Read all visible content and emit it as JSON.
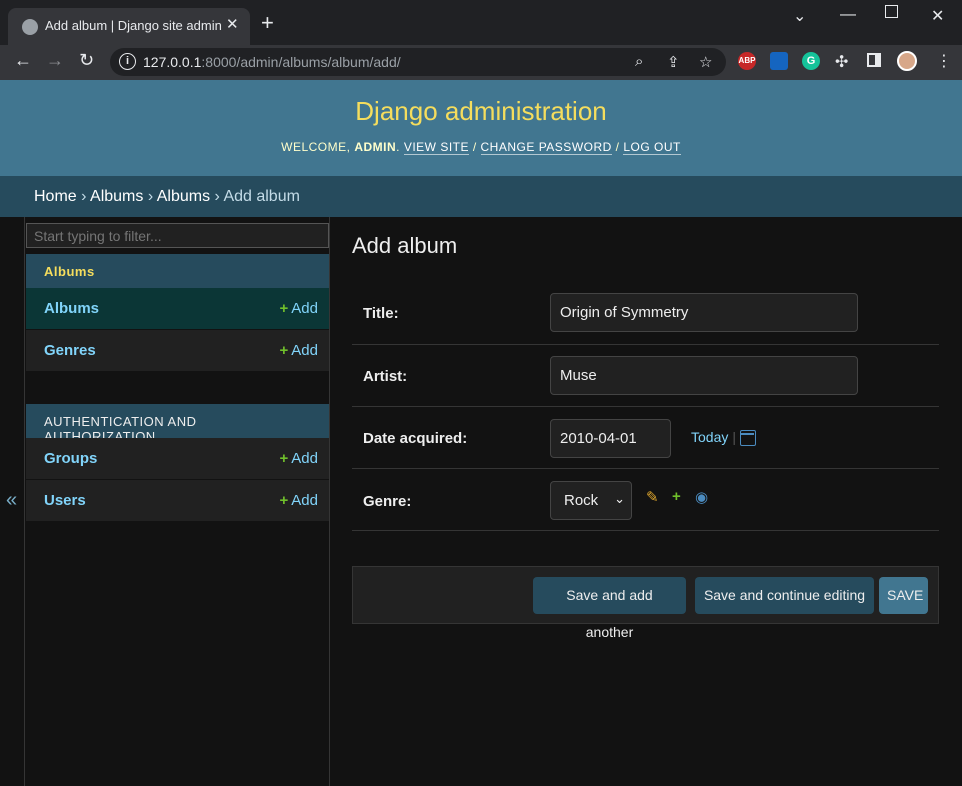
{
  "browser": {
    "tab_title": "Add album | Django site admin",
    "tab_close": "✕",
    "new_tab": "+",
    "url_host": "127.0.0.1",
    "url_rest": ":8000/admin/albums/album/add/",
    "ext_abp": "ABP",
    "ext_grammarly": "G",
    "icons": [
      "back-icon",
      "forward-icon",
      "reload-icon",
      "info-icon",
      "zoom-icon",
      "share-icon",
      "star-icon",
      "extensions-icon",
      "sidepanel-icon",
      "profile-icon"
    ]
  },
  "header": {
    "site_name": "Django administration",
    "welcome": "Welcome, ",
    "user": "admin",
    "view_site": "View site",
    "change_password": "Change password",
    "log_out": "Log out"
  },
  "breadcrumbs": {
    "home": "Home",
    "app": "Albums",
    "model": "Albums",
    "current": "Add album",
    "separator": " › "
  },
  "sidebar": {
    "toggle": "«",
    "filter_placeholder": "Start typing to filter...",
    "add_label": "Add",
    "modules": [
      {
        "caption": "Albums",
        "rows": [
          {
            "name": "Albums"
          },
          {
            "name": "Genres"
          }
        ]
      },
      {
        "caption": "Authentication and Authorization",
        "rows": [
          {
            "name": "Groups"
          },
          {
            "name": "Users"
          }
        ]
      }
    ]
  },
  "form": {
    "title": "Add album",
    "fields": {
      "title": {
        "label": "Title:",
        "value": "Origin of Symmetry"
      },
      "artist": {
        "label": "Artist:",
        "value": "Muse"
      },
      "date_acquired": {
        "label": "Date acquired:",
        "value": "2010-04-01",
        "today_label": "Today"
      },
      "genre": {
        "label": "Genre:",
        "value": "Rock"
      }
    }
  },
  "buttons": {
    "save_add_another": "Save and add another",
    "save_continue": "Save and continue editing",
    "save": "Save"
  },
  "colors": {
    "header_bg": "#417690",
    "breadcrumbs_bg": "#264b5d",
    "link": "#81d4fa",
    "site_name": "#f5dd5d",
    "add_plus": "#70bf2b"
  }
}
